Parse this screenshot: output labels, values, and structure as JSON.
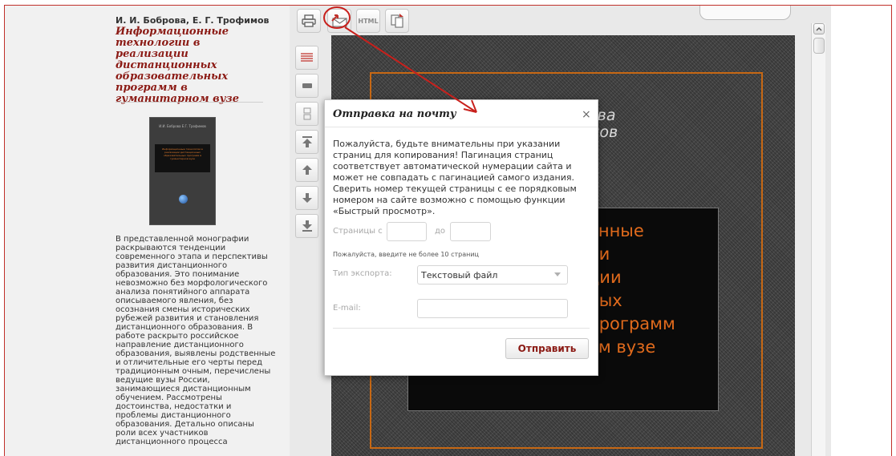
{
  "sidebar": {
    "author": "И. И. Боброва, Е. Г. Трофимов",
    "title": "Информационные технологии в реализации дистанционных образовательных программ в гуманитарном вузе",
    "cover": {
      "authors": "И.И. Боброва\nЕ.Г. Трофимов",
      "title": "Информационные технологии в реализации дистанционных образовательных программ в гуманитарном вузе"
    },
    "description": "В представленной монографии раскрываются тенденции современного этапа и перспективы развития дистанционного образования. Это понимание невозможно без морфологического анализа понятийного аппарата описываемого явления, без осознания смены исторических рубежей развития и становления дистанционного образования. В работе раскрыто российское направление дистанционного образования, выявлены родственные и отличительные его черты перед традиционным очным, перечислены ведущие вузы России, занимающиеся дистанционным обучением. Рассмотрены достоинства, недостатки и проблемы дистанционного образования. Детально описаны роли всех участников дистанционного процесса"
  },
  "toolbar": {
    "html_label": "HTML"
  },
  "viewer": {
    "author_lines": [
      "ова",
      "мов"
    ],
    "title_lines": [
      "онные",
      "ии",
      "ции",
      "ных",
      "программ",
      "ом вузе"
    ]
  },
  "dialog": {
    "title": "Отправка на почту",
    "close": "×",
    "message": "Пожалуйста, будьте внимательны при указании страниц для копирования! Пагинация страниц соответствует автоматической нумерации сайта и может не совпадать с пагинацией самого издания. Сверить номер текущей страницы с ее порядковым номером на сайте возможно с помощью функции «Быстрый просмотр».",
    "pages_from_label": "Страницы с",
    "pages_to_label": "до",
    "pages_from_value": "",
    "pages_to_value": "",
    "pages_hint": "Пожалуйста, введите не более 10 страниц",
    "export_label": "Тип экспорта:",
    "export_value": "Текстовый файл",
    "email_label": "E-mail:",
    "email_value": "",
    "send_label": "Отправить"
  },
  "colors": {
    "accent_red": "#8b1a14",
    "annotation_red": "#c8201c",
    "cover_orange": "#e06a1c"
  }
}
